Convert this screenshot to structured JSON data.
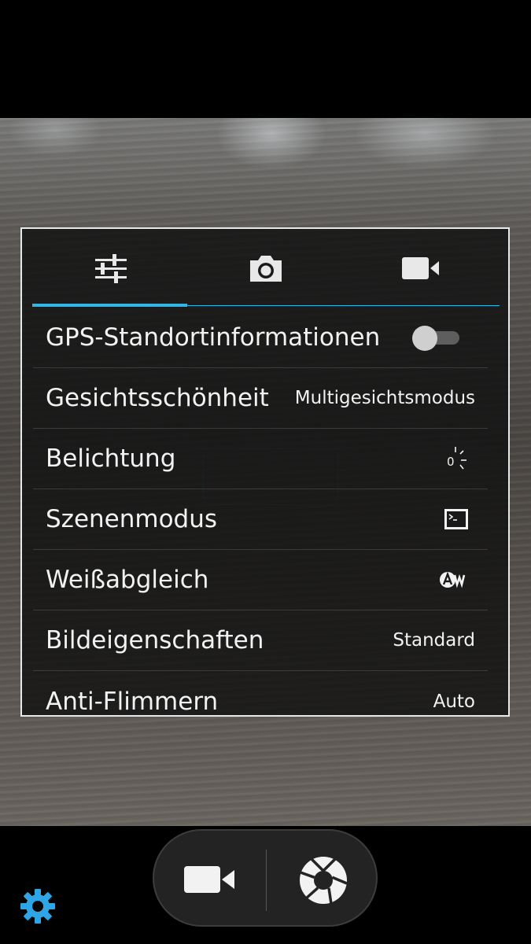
{
  "colors": {
    "accent": "#33b5e5",
    "panel_border": "#e8e8e8",
    "settings_gear": "#2ea6e6"
  },
  "tabs": [
    {
      "icon": "sliders-icon",
      "selected": true
    },
    {
      "icon": "camera-icon",
      "selected": false
    },
    {
      "icon": "video-camera-icon",
      "selected": false
    }
  ],
  "settings": {
    "gps": {
      "label": "GPS-Standortinformationen",
      "toggle_on": false
    },
    "face_beauty": {
      "label": "Gesichtsschönheit",
      "value": "Multigesichtsmodus"
    },
    "exposure": {
      "label": "Belichtung",
      "value": "0",
      "icon": "exposure-icon"
    },
    "scene_mode": {
      "label": "Szenenmodus",
      "icon": "scene-mode-icon"
    },
    "white_balance": {
      "label": "Weißabgleich",
      "icon": "auto-white-balance-icon"
    },
    "picture_properties": {
      "label": "Bildeigenschaften",
      "value": "Standard"
    },
    "anti_flicker": {
      "label": "Anti-Flimmern",
      "value": "Auto"
    }
  },
  "bottom": {
    "video_button_icon": "video-camera-icon",
    "shutter_button_icon": "shutter-icon",
    "settings_icon": "gear-icon"
  }
}
